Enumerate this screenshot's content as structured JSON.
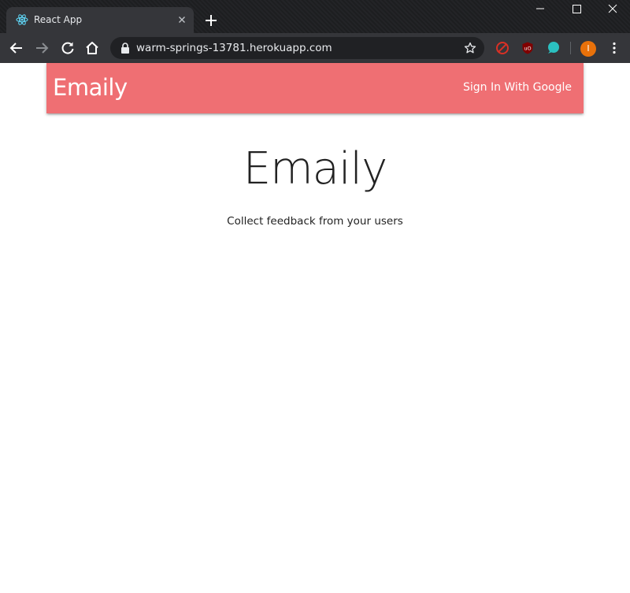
{
  "browser": {
    "tab": {
      "title": "React App",
      "favicon": "react-atom-icon"
    },
    "address_bar": {
      "url": "warm-springs-13781.herokuapp.com"
    },
    "profile_initial": "I",
    "extensions": [
      "block-icon",
      "ublock-origin-icon",
      "teal-circle-icon"
    ],
    "colors": {
      "frame": "#202124",
      "toolbar": "#35363a",
      "avatar": "#e8710a"
    }
  },
  "navbar": {
    "brand": "Emaily",
    "signin_label": "Sign In With Google",
    "color": "#ef6f73"
  },
  "hero": {
    "title": "Emaily",
    "subtitle": "Collect feedback from your users"
  }
}
